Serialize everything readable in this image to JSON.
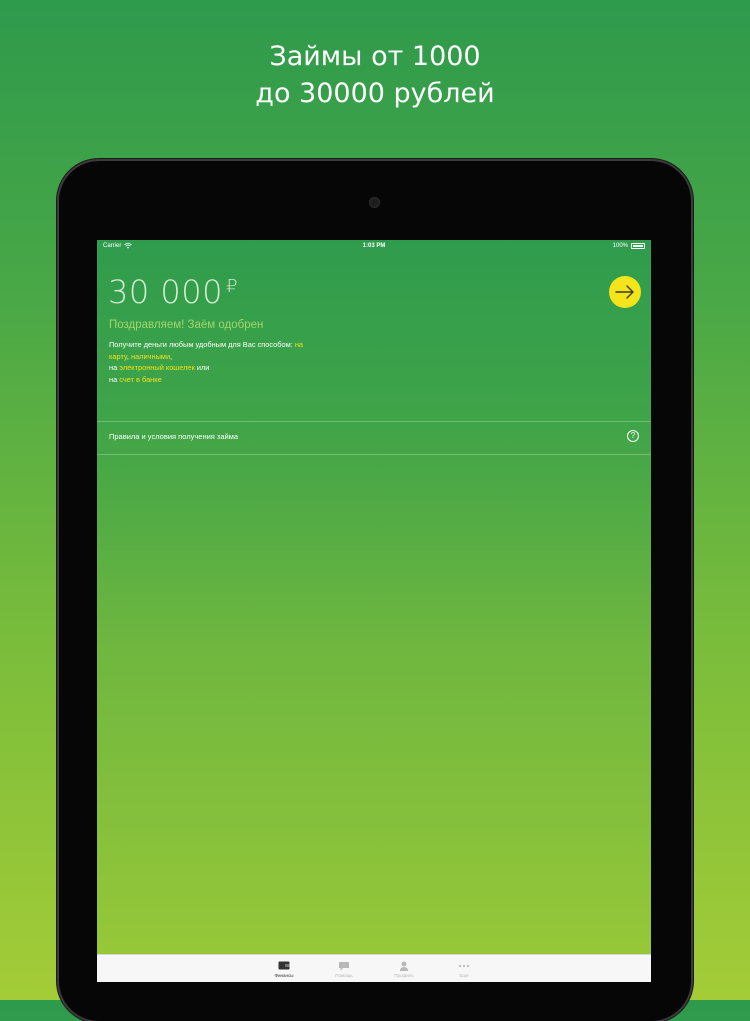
{
  "promo": {
    "line1": "Займы от 1000",
    "line2": "до 30000 рублей"
  },
  "status_bar": {
    "carrier": "Carrier",
    "time": "1:03 PM",
    "battery": "100%"
  },
  "loan": {
    "amount": "30 000",
    "currency": "₽",
    "approved_text": "Поздравляем! Заём одобрен",
    "info_prefix": "Получите деньги любым удобным для Вас способом:",
    "link_card": "на карту",
    "sep1": ",",
    "link_cash": "наличными",
    "sep2": ",",
    "info_na": "на",
    "link_ewallet": "электронный кошелек",
    "info_or": "или",
    "info_na2": "на",
    "link_bank": "счет в банке"
  },
  "rules": {
    "label": "Правила и условия получения займа",
    "help_glyph": "?"
  },
  "tabs": [
    {
      "label": "Финансы",
      "icon": "wallet-icon",
      "active": true
    },
    {
      "label": "Помощь",
      "icon": "chat-icon",
      "active": false
    },
    {
      "label": "Профиль",
      "icon": "person-icon",
      "active": false
    },
    {
      "label": "Ещё",
      "icon": "more-icon",
      "active": false
    }
  ],
  "colors": {
    "accent_yellow": "#f3e41b",
    "background_green": "#2e9a4c",
    "background_lime": "#a4cc37"
  }
}
